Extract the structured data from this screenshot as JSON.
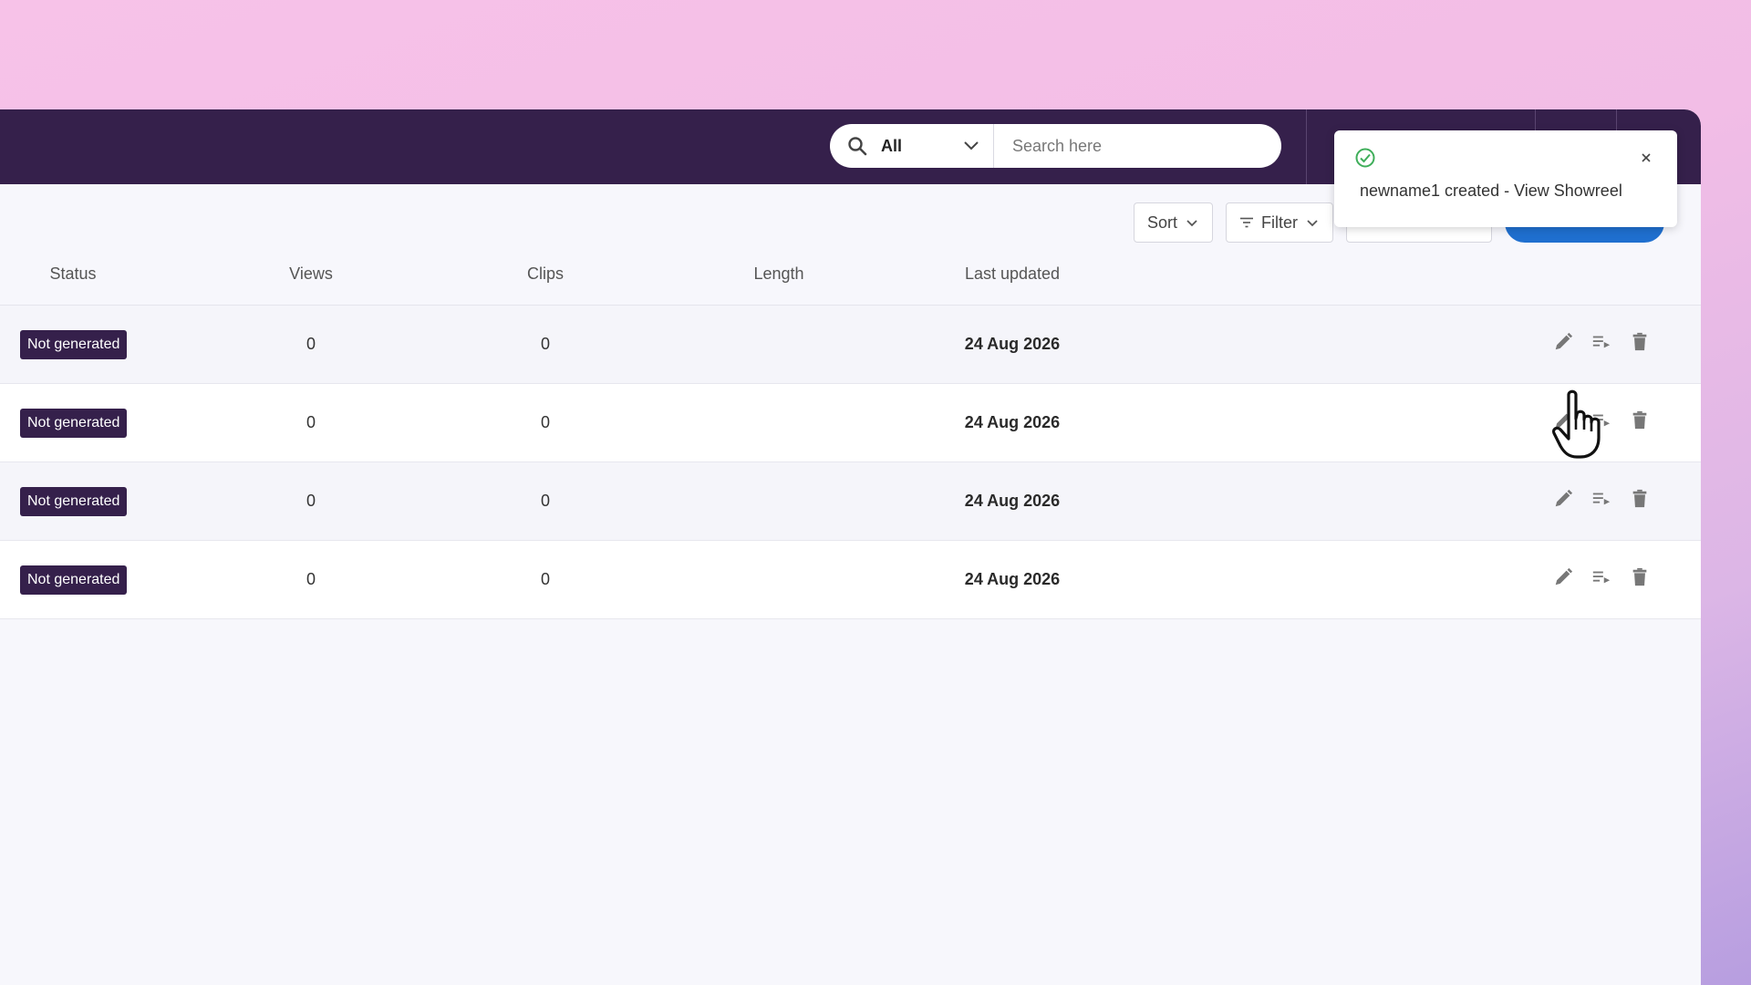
{
  "search": {
    "scope_value": "All",
    "placeholder": "Search here"
  },
  "toolbar": {
    "sort_label": "Sort",
    "filter_label": "Filter"
  },
  "table": {
    "columns": [
      "Status",
      "Views",
      "Clips",
      "Length",
      "Last updated"
    ],
    "rows": [
      {
        "status": "Not generated",
        "views": "0",
        "clips": "0",
        "length": "",
        "last_updated": "24 Aug 2026"
      },
      {
        "status": "Not generated",
        "views": "0",
        "clips": "0",
        "length": "",
        "last_updated": "24 Aug 2026"
      },
      {
        "status": "Not generated",
        "views": "0",
        "clips": "0",
        "length": "",
        "last_updated": "24 Aug 2026"
      },
      {
        "status": "Not generated",
        "views": "0",
        "clips": "0",
        "length": "",
        "last_updated": "24 Aug 2026"
      }
    ]
  },
  "toast": {
    "message": "newname1 created - View Showreel"
  },
  "icons": {
    "search": "search-icon",
    "chevron": "chevron-down-icon",
    "filter": "filter-icon",
    "edit": "pencil-icon",
    "list": "playlist-icon",
    "delete": "trash-icon",
    "success": "check-circle-icon",
    "close": "close-icon",
    "cursor": "hand-cursor-icon"
  },
  "colors": {
    "topbar": "#35204b",
    "badge": "#35204b",
    "primary": "#1f6fcf",
    "success": "#3fae5a"
  }
}
